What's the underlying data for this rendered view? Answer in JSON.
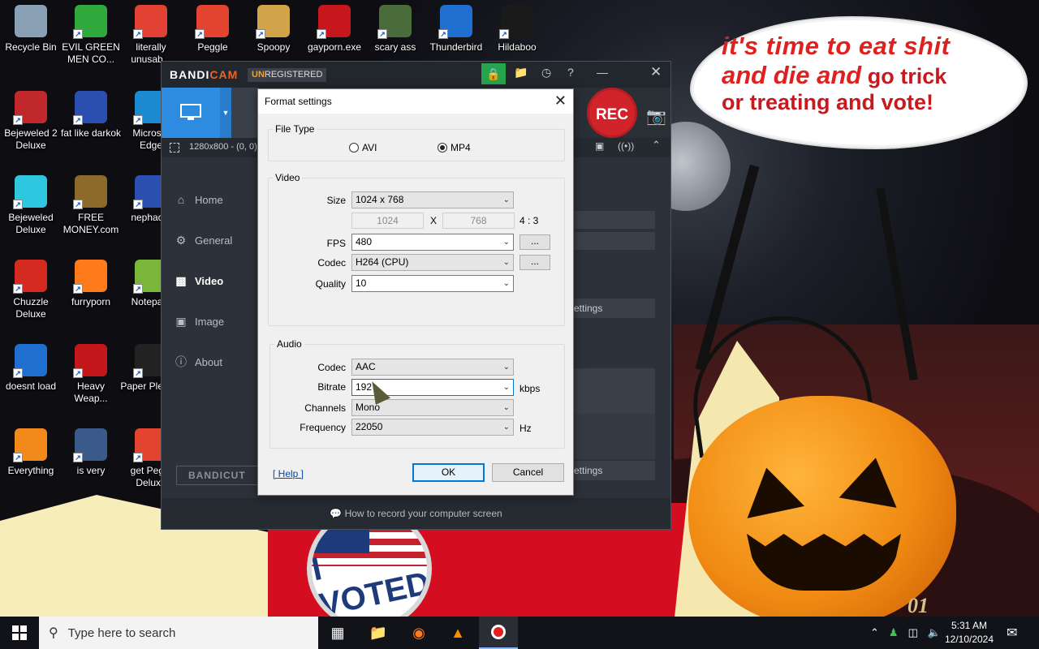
{
  "desktop": {
    "icons": [
      {
        "label": "Recycle Bin",
        "icon": "recycle-bin-icon",
        "color": "#8aa0b5"
      },
      {
        "label": "EVIL GREEN MEN CO...",
        "icon": "green-men-icon",
        "color": "#2fa83c"
      },
      {
        "label": "literally unusab...",
        "icon": "chrome-icon",
        "color": "#e34133"
      },
      {
        "label": "Peggle",
        "icon": "peggle-icon",
        "color": "#e2442f"
      },
      {
        "label": "Spoopy",
        "icon": "folder-icon",
        "color": "#d2a44a"
      },
      {
        "label": "gayporn.exe",
        "icon": "flash-icon",
        "color": "#c8161d"
      },
      {
        "label": "scary ass",
        "icon": "game-icon",
        "color": "#4a6b3a"
      },
      {
        "label": "Thunderbird",
        "icon": "thunderbird-icon",
        "color": "#1f6fd1"
      },
      {
        "label": "Hildaboo",
        "icon": "yashima-icon",
        "color": "#1a1a1a"
      },
      {
        "label": "Bejeweled 2 Deluxe",
        "icon": "bejeweled2-icon",
        "color": "#c0282b"
      },
      {
        "label": "fat like darkok",
        "icon": "mpl-icon",
        "color": "#2a4fb0"
      },
      {
        "label": "Micros... Edge",
        "icon": "edge-icon",
        "color": "#1c8ad0"
      },
      {
        "label": "Bejeweled Deluxe",
        "icon": "diamond-icon",
        "color": "#2fc7e0"
      },
      {
        "label": "FREE MONEY.com",
        "icon": "money-bag-icon",
        "color": "#8b6a2a"
      },
      {
        "label": "nephac...",
        "icon": "mpl-icon",
        "color": "#2a4fb0"
      },
      {
        "label": "Chuzzle Deluxe",
        "icon": "chuzzle-icon",
        "color": "#d42a20"
      },
      {
        "label": "furryporn",
        "icon": "firefox-icon",
        "color": "#ff7a1a"
      },
      {
        "label": "Notepa...",
        "icon": "notepad-icon",
        "color": "#7ab63a"
      },
      {
        "label": "doesnt load",
        "icon": "thunderbird-icon",
        "color": "#1f6fd1"
      },
      {
        "label": "Heavy Weap...",
        "icon": "radiation-icon",
        "color": "#c3171c"
      },
      {
        "label": "Paper Pleas...",
        "icon": "paper-please-icon",
        "color": "#222"
      },
      {
        "label": "Everything",
        "icon": "search-icon",
        "color": "#f28a1b"
      },
      {
        "label": "is very",
        "icon": "shield-icon",
        "color": "#3a5a8a"
      },
      {
        "label": "get Peggl Deluxe",
        "icon": "peggle-icon",
        "color": "#e2442f"
      }
    ],
    "bubble": {
      "line1": "it's time to eat shit",
      "line2a": "and die and",
      "line2b": "go trick",
      "line3": "or treating and vote!"
    },
    "badge_text": "I VOTED",
    "corner_text": "01"
  },
  "bandicam": {
    "brand_a": "BANDI",
    "brand_b": "CAM",
    "unreg_a": "UN",
    "unreg_b": "REGISTERED",
    "rec_label": "REC",
    "resolution": "1280x800 - (0, 0)",
    "nav": [
      "Home",
      "General",
      "Video",
      "Image",
      "About"
    ],
    "active_nav": "Video",
    "bandicut": "BANDICUT",
    "settings_btn_1": "ettings",
    "settings_btn_2": "ettings",
    "footer": "How to record your computer screen"
  },
  "dialog": {
    "title": "Format settings",
    "file_type_legend": "File Type",
    "file_types": [
      "AVI",
      "MP4"
    ],
    "file_type_selected": "MP4",
    "video_legend": "Video",
    "size_label": "Size",
    "size_value": "1024 x 768",
    "width_value": "1024",
    "x_label": "X",
    "height_value": "768",
    "aspect": "4 : 3",
    "fps_label": "FPS",
    "fps_value": "480",
    "codec_label": "Codec",
    "codec_value": "H264 (CPU)",
    "quality_label": "Quality",
    "quality_value": "10",
    "ellipsis": "...",
    "audio_legend": "Audio",
    "audio_codec_label": "Codec",
    "audio_codec_value": "AAC",
    "bitrate_label": "Bitrate",
    "bitrate_value": "192",
    "bitrate_unit": "kbps",
    "channels_label": "Channels",
    "channels_value": "Mono",
    "frequency_label": "Frequency",
    "frequency_value": "22050",
    "frequency_unit": "Hz",
    "help": "[ Help ]",
    "ok": "OK",
    "cancel": "Cancel"
  },
  "taskbar": {
    "search_placeholder": "Type here to search",
    "time": "5:31 AM",
    "date": "12/10/2024"
  }
}
